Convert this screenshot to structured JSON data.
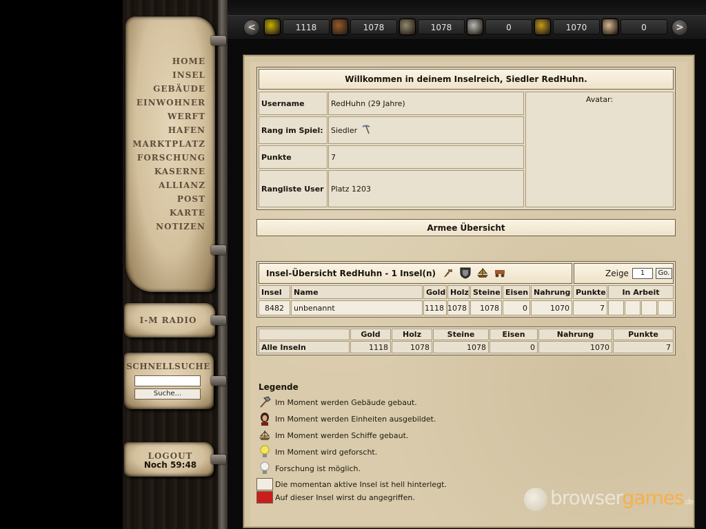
{
  "nav": {
    "items": [
      "HOME",
      "INSEL",
      "GEBÄUDE",
      "EINWOHNER",
      "WERFT",
      "HAFEN",
      "MARKTPLATZ",
      "FORSCHUNG",
      "KASERNE",
      "ALLIANZ",
      "POST",
      "KARTE",
      "NOTIZEN"
    ]
  },
  "radio": {
    "label": "I-M RADIO"
  },
  "quicksearch": {
    "title": "SCHNELLSUCHE",
    "input_value": "",
    "button_label": "Suche..."
  },
  "logout": {
    "label": "LOGOUT",
    "timer": "Noch 59:48"
  },
  "resources": {
    "prev_arrow": "<",
    "next_arrow": ">",
    "items": [
      {
        "icon": "gold-icon",
        "value": "1118",
        "color": "#c8b000"
      },
      {
        "icon": "wood-icon",
        "value": "1078",
        "color": "#9a5a2a"
      },
      {
        "icon": "stone-icon",
        "value": "1078",
        "color": "#8f8a70"
      },
      {
        "icon": "iron-icon",
        "value": "0",
        "color": "#b8b8b8"
      },
      {
        "icon": "food-icon",
        "value": "1070",
        "color": "#c49a1a"
      },
      {
        "icon": "population-icon",
        "value": "0",
        "color": "#d8b890"
      }
    ]
  },
  "welcome": {
    "title": "Willkommen in deinem Inselreich, Siedler RedHuhn.",
    "avatar_label": "Avatar:",
    "rows": [
      {
        "label": "Username",
        "value": "RedHuhn (29 Jahre)"
      },
      {
        "label": "Rang im Spiel:",
        "value": "Siedler"
      },
      {
        "label": "Punkte",
        "value": "7"
      },
      {
        "label": "Rangliste User",
        "value": "Platz 1203"
      }
    ]
  },
  "army": {
    "title": "Armee Übersicht"
  },
  "island_overview": {
    "title": "Insel-Übersicht RedHuhn - 1 Insel(n)",
    "show_label": "Zeige",
    "show_value": "1",
    "go_label": "Go.",
    "columns": [
      "Insel",
      "Name",
      "Gold",
      "Holz",
      "Steine",
      "Eisen",
      "Nahrung",
      "Punkte",
      "In Arbeit"
    ],
    "rows": [
      {
        "insel": "8482",
        "name": "unbenannt",
        "gold": "1118",
        "holz": "1078",
        "steine": "1078",
        "eisen": "0",
        "nahrung": "1070",
        "punkte": "7"
      }
    ]
  },
  "totals": {
    "columns": [
      "Gold",
      "Holz",
      "Steine",
      "Eisen",
      "Nahrung",
      "Punkte"
    ],
    "row_label": "Alle Inseln",
    "values": [
      "1118",
      "1078",
      "1078",
      "0",
      "1070",
      "7"
    ]
  },
  "legend": {
    "title": "Legende",
    "items": [
      {
        "icon": "hammer-icon",
        "text": "Im Moment werden Gebäude gebaut."
      },
      {
        "icon": "person-icon",
        "text": "Im Moment werden Einheiten ausgebildet."
      },
      {
        "icon": "ship-icon",
        "text": "Im Moment werden Schiffe gebaut."
      },
      {
        "icon": "lightbulb-on-icon",
        "text": "Im Moment wird geforscht."
      },
      {
        "icon": "lightbulb-off-icon",
        "text": "Forschung ist möglich."
      },
      {
        "icon": "active-swatch",
        "text": "Die momentan aktive Insel ist hell hinterlegt.",
        "color": "#f3ece0"
      },
      {
        "icon": "attacked-swatch",
        "text": "Auf dieser Insel wirst du angegriffen.",
        "color": "#c81e1e"
      }
    ]
  },
  "watermark": {
    "main": "browser",
    "accent": "games",
    "tld": ".de"
  }
}
